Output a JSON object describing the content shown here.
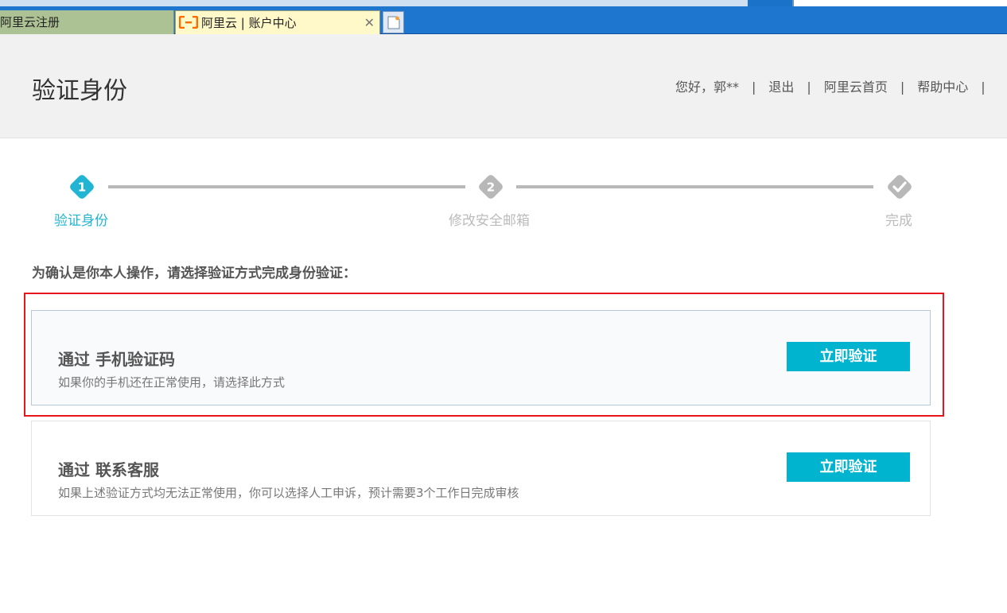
{
  "browser": {
    "tabs": [
      {
        "label": "阿里云注册",
        "active": false
      },
      {
        "label": "阿里云 | 账户中心",
        "active": true
      }
    ],
    "close_glyph": "✕",
    "new_tab_icon": "new-tab-icon"
  },
  "header": {
    "title": "验证身份",
    "nav": {
      "greeting": "您好，郭**",
      "logout": "退出",
      "home": "阿里云首页",
      "help": "帮助中心",
      "sep": "|"
    }
  },
  "steps": [
    {
      "number": "1",
      "label": "验证身份",
      "state": "active"
    },
    {
      "number": "2",
      "label": "修改安全邮箱",
      "state": "pending"
    },
    {
      "number": "check-icon",
      "label": "完成",
      "state": "pending"
    }
  ],
  "intro": "为确认是你本人操作，请选择验证方式完成身份验证：",
  "options": [
    {
      "title": "通过 手机验证码",
      "desc": "如果你的手机还在正常使用，请选择此方式",
      "button": "立即验证"
    },
    {
      "title": "通过 联系客服",
      "desc": "如果上述验证方式均无法正常使用，你可以选择人工申诉，预计需要3个工作日完成审核",
      "button": "立即验证"
    }
  ],
  "colors": {
    "accent": "#00b4d0",
    "step_active": "#21b5d3",
    "step_inactive": "#b8b8b8",
    "highlight": "#e8161c"
  }
}
